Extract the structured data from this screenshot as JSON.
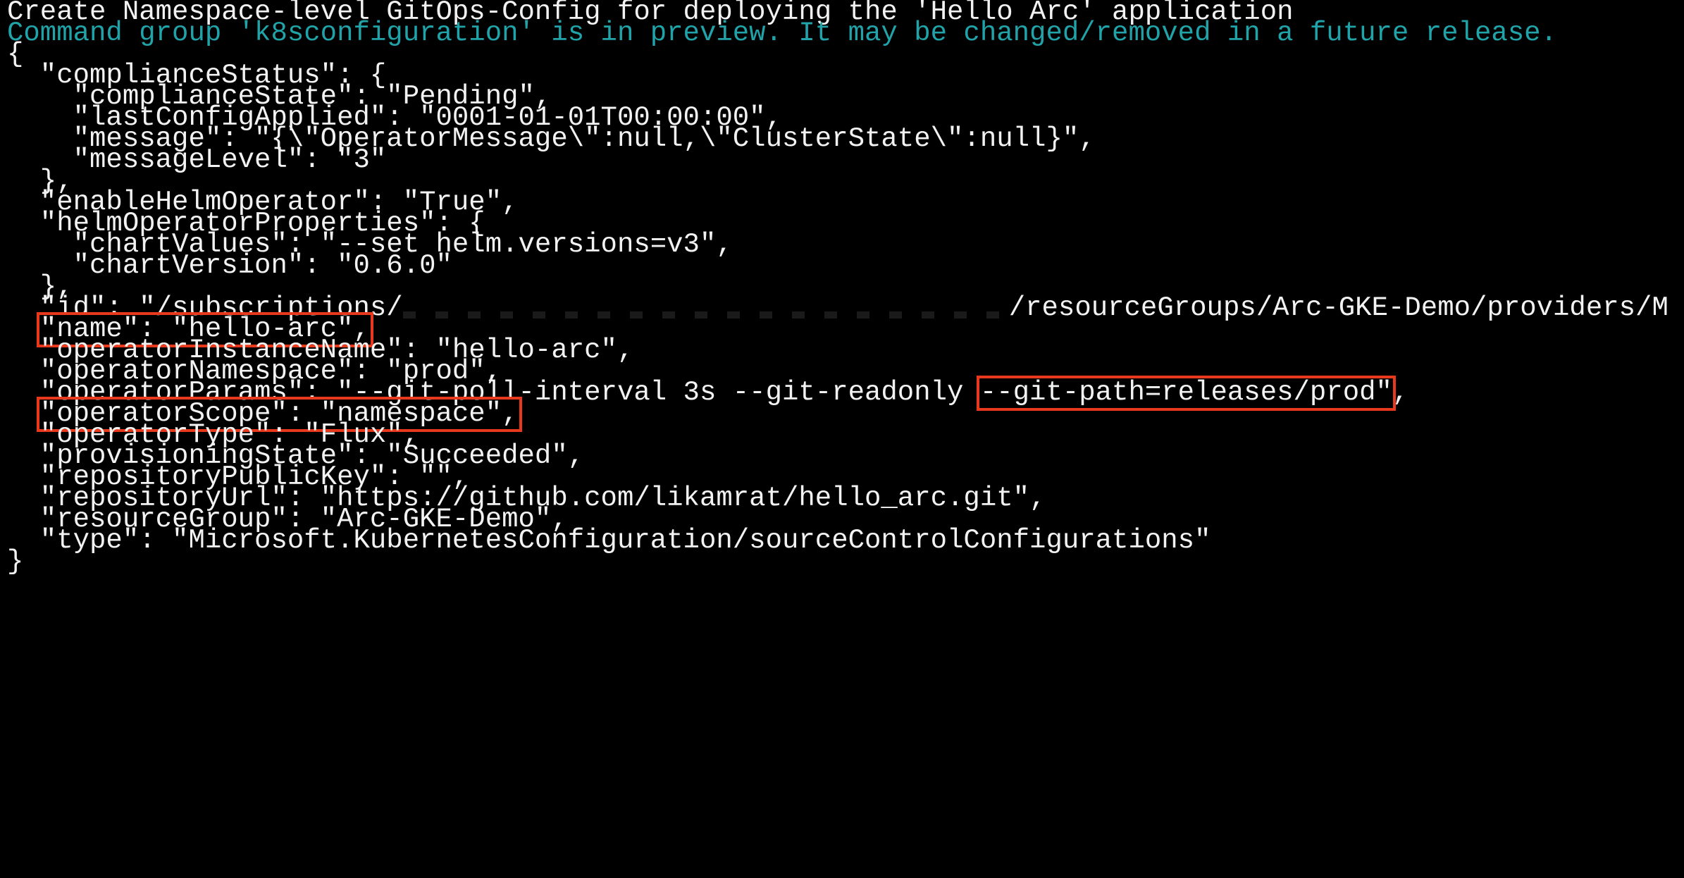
{
  "terminal": {
    "header": "Create Namespace-level GitOps-Config for deploying the 'Hello Arc' application",
    "preview_warning": "Command group 'k8sconfiguration' is in preview. It may be changed/removed in a future release.",
    "lines": {
      "open_brace": "{",
      "compliance_status_open": "  \"complianceStatus\": {",
      "compliance_state": "    \"complianceState\": \"Pending\",",
      "last_config_applied": "    \"lastConfigApplied\": \"0001-01-01T00:00:00\",",
      "message": "    \"message\": \"{\\\"OperatorMessage\\\":null,\\\"ClusterState\\\":null}\",",
      "message_level": "    \"messageLevel\": \"3\"",
      "compliance_status_close": "  },",
      "enable_helm_operator": "  \"enableHelmOperator\": \"True\",",
      "helm_operator_properties_open": "  \"helmOperatorProperties\": {",
      "chart_values": "    \"chartValues\": \"--set helm.versions=v3\",",
      "chart_version": "    \"chartVersion\": \"0.6.0\"",
      "helm_operator_properties_close": "  },",
      "id_prefix": "  \"id\": \"/subscriptions/",
      "id_suffix": "/resourceGroups/Arc-GKE-Demo/providers/M",
      "name_indent": "  ",
      "name_highlight": "\"name\": \"hello-arc\",",
      "operator_instance_name": "  \"operatorInstanceName\": \"hello-arc\",",
      "operator_namespace": "  \"operatorNamespace\": \"prod\",",
      "operator_params_prefix": "  \"operatorParams\": \"--git-poll-interval 3s --git-readonly ",
      "operator_params_highlight": "--git-path=releases/prod\"",
      "operator_params_suffix": ",",
      "operator_scope_indent": "  ",
      "operator_scope_highlight": "\"operatorScope\": \"namespace\",",
      "operator_type": "  \"operatorType\": \"Flux\",",
      "provisioning_state": "  \"provisioningState\": \"Succeeded\",",
      "repository_public_key": "  \"repositoryPublicKey\": \"\",",
      "repository_url": "  \"repositoryUrl\": \"https://github.com/likamrat/hello_arc.git\",",
      "resource_group": "  \"resourceGroup\": \"Arc-GKE-Demo\",",
      "type": "  \"type\": \"Microsoft.KubernetesConfiguration/sourceControlConfigurations\"",
      "close_brace": "}"
    }
  },
  "colors": {
    "background": "#000000",
    "text": "#f2f2f2",
    "info_text": "#20a3a9",
    "highlight_box": "#e8391c"
  }
}
